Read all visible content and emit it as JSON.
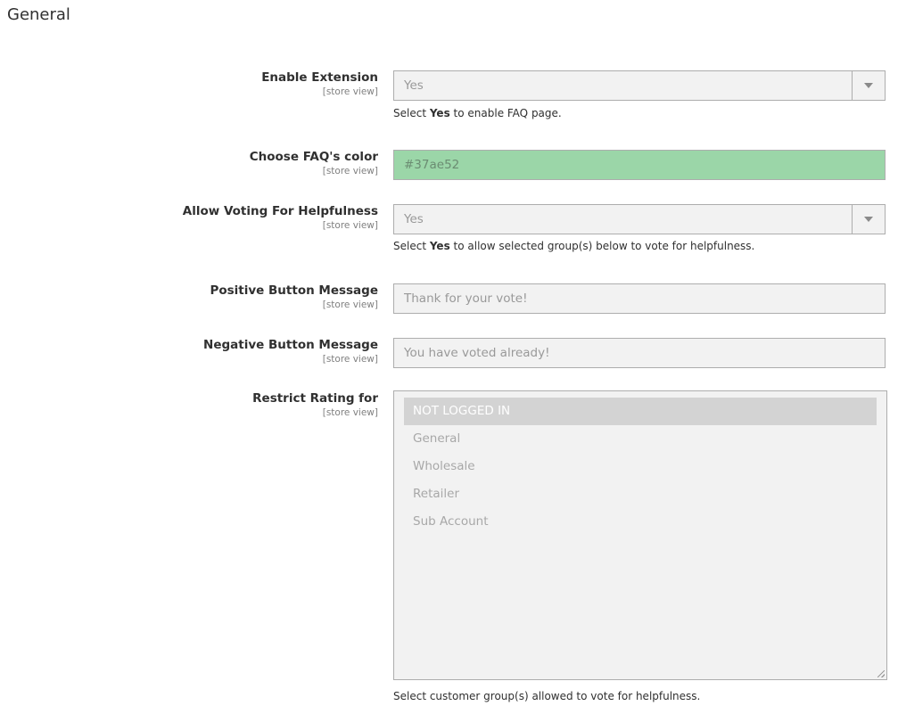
{
  "section": {
    "title": "General"
  },
  "fields": {
    "enable_extension": {
      "label": "Enable Extension",
      "scope": "[store view]",
      "value": "Yes",
      "note_prefix": "Select ",
      "note_bold": "Yes",
      "note_suffix": " to enable FAQ page."
    },
    "faq_color": {
      "label": "Choose FAQ's color",
      "scope": "[store view]",
      "value": "#37ae52",
      "swatch_color": "#9bd6a8"
    },
    "allow_voting": {
      "label": "Allow Voting For Helpfulness",
      "scope": "[store view]",
      "value": "Yes",
      "note_prefix": "Select ",
      "note_bold": "Yes",
      "note_suffix": " to allow selected group(s) below to vote for helpfulness."
    },
    "positive_message": {
      "label": "Positive Button Message",
      "scope": "[store view]",
      "value": "Thank for your vote!"
    },
    "negative_message": {
      "label": "Negative Button Message",
      "scope": "[store view]",
      "value": "You have voted already!"
    },
    "restrict_rating": {
      "label": "Restrict Rating for",
      "scope": "[store view]",
      "options": [
        "NOT LOGGED IN",
        "General",
        "Wholesale",
        "Retailer",
        "Sub Account"
      ],
      "selected": "NOT LOGGED IN",
      "note": "Select customer group(s) allowed to vote for helpfulness."
    }
  },
  "icons": {
    "select_arrow": "chevron-down-icon",
    "resize": "resize-grip-icon"
  }
}
